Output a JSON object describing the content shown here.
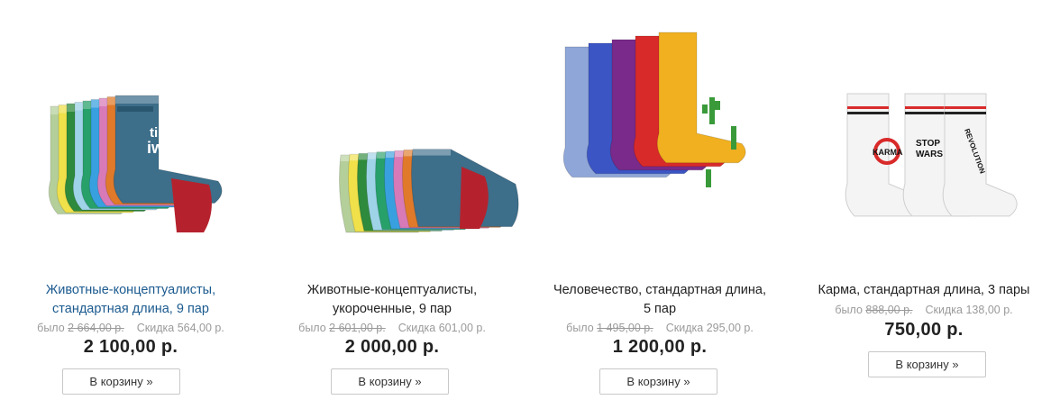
{
  "products": [
    {
      "title_line1": "Животные-концептуалисты,",
      "title_line2": "стандартная длина, 9 пар",
      "old_label": "было",
      "old_price": "2 664,00 р.",
      "discount_label": "Скидка",
      "discount": "564,00 р.",
      "price": "2 100,00 р.",
      "button": "В корзину »"
    },
    {
      "title_line1": "Животные-концептуалисты,",
      "title_line2": "укороченные, 9 пар",
      "old_label": "было",
      "old_price": "2 601,00 р.",
      "discount_label": "Скидка",
      "discount": "601,00 р.",
      "price": "2 000,00 р.",
      "button": "В корзину »"
    },
    {
      "title_line1": "Человечество, стандартная длина,",
      "title_line2": "5 пар",
      "old_label": "было",
      "old_price": "1 495,00 р.",
      "discount_label": "Скидка",
      "discount": "295,00 р.",
      "price": "1 200,00 р.",
      "button": "В корзину »"
    },
    {
      "title_line1": "Карма, стандартная длина, 3 пары",
      "old_label": "было",
      "old_price": "888,00 р.",
      "discount_label": "Скидка",
      "discount": "138,00 р.",
      "price": "750,00 р.",
      "button": "В корзину »"
    }
  ],
  "image_text": {
    "sock1_word1": "time",
    "sock1_word2": "iw",
    "karma": "KARMA",
    "stop": "STOP",
    "wars": "WARS",
    "revolution": "REVOLUTION"
  },
  "colors": {
    "link": "#1b5a8f",
    "price": "#222222",
    "muted": "#9a9a9a",
    "button_border": "#c8c8c8"
  }
}
